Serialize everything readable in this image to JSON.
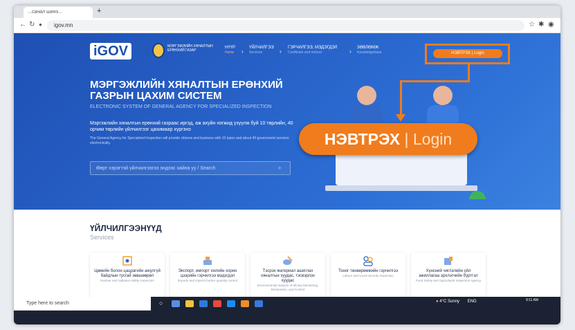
{
  "browser": {
    "tab_title": "...санал шинэ...",
    "new_tab": "+",
    "url": "igov.mn"
  },
  "header": {
    "logo": "iGOV",
    "org_name": "Мэргэжлийн хяналтын ерөнхий газар",
    "menu": [
      {
        "mn": "НҮҮР",
        "en": "Home"
      },
      {
        "mn": "ҮЙЛЧИЛГЭЭ",
        "en": "Services"
      },
      {
        "mn": "ГЭРЧИЛГЭЭ, МЭДЭГДЭЛ",
        "en": "Certificate and notices"
      },
      {
        "mn": "ЗӨВЛӨМЖ",
        "en": "Knowledgebase"
      }
    ],
    "login": "НЭВТРЭХ | Login"
  },
  "hero": {
    "title": "МЭРГЭЖЛИЙН ХЯНАЛТЫН ЕРӨНХИЙ ГАЗРЫН ЦАХИМ СИСТЕМ",
    "subtitle": "ELECTRONIC SYSTEM OF GENERAL AGENCY FOR SPECIALIZED INSPECTION",
    "desc_mn": "Мэргэжлийн хяналтын ерөнхий газраас иргэд, аж ахуйн нэгжид үзүүлж буй 10 төрлийн, 40 орчим төрлийн үйлчилгээг цахимаар хүргэнэ",
    "desc_en": "The General Agency for Specialized Inspection will provide citizens and business with 10 types and about 40 government services electronically.",
    "search_placeholder": "Өөрт хэрэгтэй үйлчилгээгээ эндээс хайна уу / Search",
    "big_login_mn": "НЭВТРЭХ",
    "big_login_sep": " | ",
    "big_login_en": "Login"
  },
  "services": {
    "title": "ҮЙЛЧИЛГЭЭНҮҮД",
    "subtitle": "Services",
    "cards": [
      {
        "title": "Цөмийн болон цацрагийн аюулгүй байдлын тусгай зөвшөөрөл",
        "sub": "Nuclear and radiation safety inspection",
        "icon": "radiation-icon"
      },
      {
        "title": "Экспорт, импорт хилийн хориo цээрийн гэрчилгээ мэдэгдэл",
        "sub": "Exports and imports border quantity control",
        "icon": "export-icon"
      },
      {
        "title": "Тэсрэх материал ашиглах хяналтын хуудас, тэсвэрлэх хуудас",
        "sub": "Environmental impacts of Mining Monitoring, Restoration, and Control",
        "icon": "mining-icon"
      },
      {
        "title": "Тоног төхөөрөмжийн гэрчилгээ",
        "sub": "Labour and social security inspection",
        "icon": "people-icon"
      },
      {
        "title": "Хүнсний чиглэлийн үйл ажиллагаа эрхлэгчийн бүртгэл",
        "sub": "Food Safety and Agricultural Inspection Agency",
        "icon": "food-icon"
      }
    ]
  },
  "taskbar": {
    "search": "Type here to search",
    "weather": "4°C Sunny",
    "lang": "ENG",
    "time": "9:11 AM"
  }
}
